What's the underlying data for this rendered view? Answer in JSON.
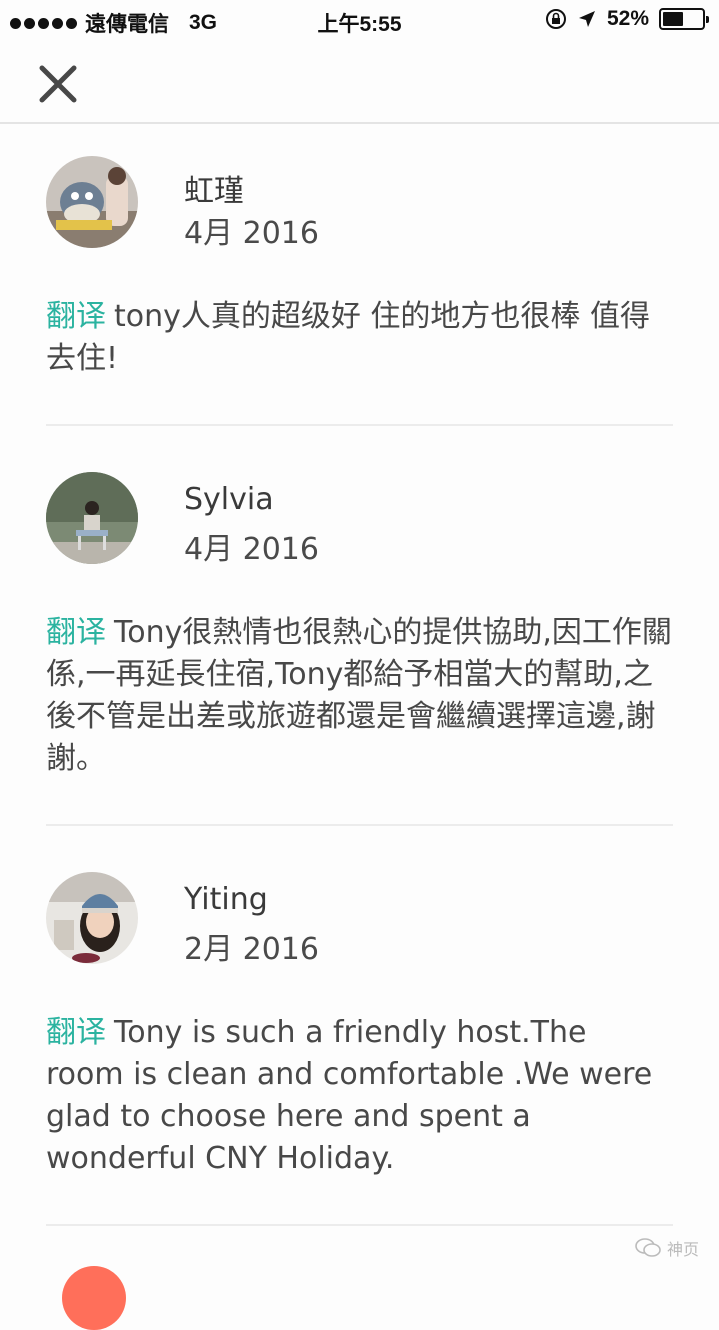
{
  "status_bar": {
    "carrier": "遠傳電信",
    "network": "3G",
    "time": "上午5:55",
    "battery": "52%",
    "battery_level": 0.52,
    "icons": [
      "signal-dots-icon",
      "orientation-lock-icon",
      "location-arrow-icon",
      "battery-icon"
    ]
  },
  "nav": {
    "close_icon": "close-icon"
  },
  "reviews": [
    {
      "name": "虹瑾",
      "date": "4月 2016",
      "translate_label": "翻译",
      "text": "tony人真的超级好 住的地方也很棒 值得去住!"
    },
    {
      "name": "Sylvia",
      "date": "4月 2016",
      "translate_label": "翻译",
      "text": "Tony很熱情也很熱心的提供協助,因工作關係,一再延長住宿,Tony都給予相當大的幫助,之後不管是出差或旅遊都還是會繼續選擇這邊,謝謝。"
    },
    {
      "name": "Yiting",
      "date": "2月 2016",
      "translate_label": "翻译",
      "text": "Tony is such a friendly host.The room is clean and comfortable .We were glad to choose here and spent a wonderful  CNY Holiday."
    }
  ],
  "watermark": {
    "text": "神页"
  },
  "colors": {
    "accent": "#2bb3a0",
    "text": "#484848",
    "divider": "#ececec"
  }
}
